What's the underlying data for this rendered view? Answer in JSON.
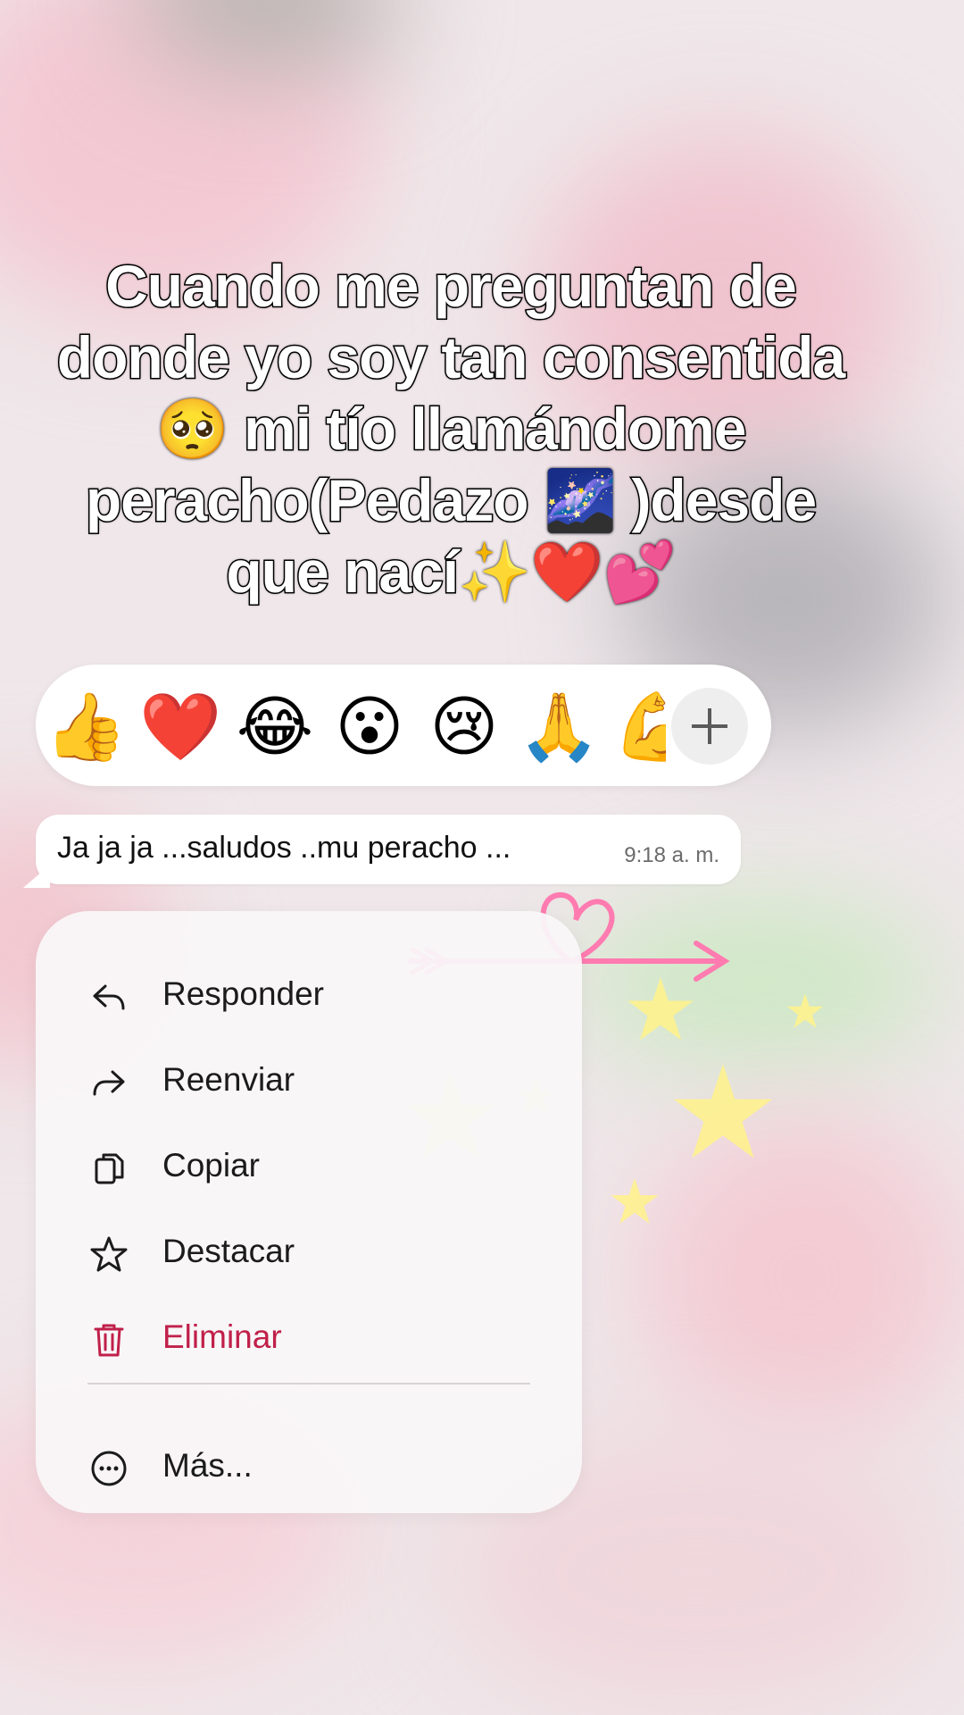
{
  "caption": "Cuando me preguntan de donde yo soy tan consentida 🥺 mi tío llamándome peracho(Pedazo 🌌 )desde que nací✨❤️💕",
  "reactions": [
    "👍",
    "❤️",
    "😂",
    "😮",
    "😢",
    "🙏",
    "💪"
  ],
  "message": {
    "text": "Ja ja ja ...saludos ..mu peracho ...",
    "time": "9:18 a. m."
  },
  "menu": {
    "reply": "Responder",
    "forward": "Reenviar",
    "copy": "Copiar",
    "star": "Destacar",
    "delete": "Eliminar",
    "more": "Más..."
  },
  "colors": {
    "delete": "#c0204a",
    "background": "#efe7ea"
  }
}
